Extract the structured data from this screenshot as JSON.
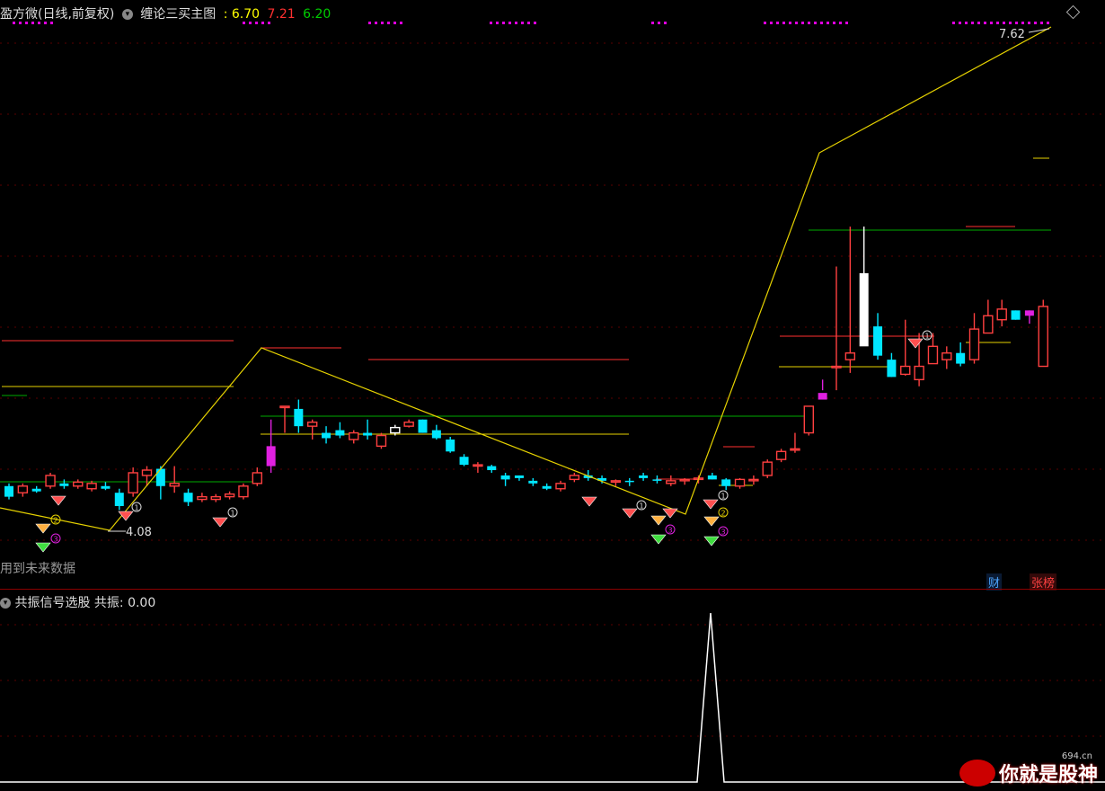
{
  "header": {
    "stock_title": "盈方微(日线,前复权)",
    "indicator_name": "缠论三买主图",
    "value1": ": 6.70",
    "value2": "7.21",
    "value3": "6.20",
    "colors": {
      "value1": "#ffff00",
      "value2": "#ff3030",
      "value3": "#00cc00"
    }
  },
  "main_chart": {
    "high_label": "7.62",
    "low_label": "4.08",
    "future_note": "用到未来数据",
    "badges": {
      "cai": "财",
      "zhangbang": "张榜"
    }
  },
  "sub_chart": {
    "title": "共振信号选股",
    "value_label": "共振: 0.00"
  },
  "watermark": {
    "text": "你就是股神",
    "site": "694.cn"
  },
  "chart_data": {
    "type": "candlestick",
    "y_range": [
      3.9,
      7.75
    ],
    "bar_count": 76,
    "ohlc": [
      [
        4.3,
        4.32,
        4.2,
        4.22
      ],
      [
        4.25,
        4.32,
        4.22,
        4.3
      ],
      [
        4.28,
        4.3,
        4.25,
        4.26
      ],
      [
        4.3,
        4.4,
        4.28,
        4.38
      ],
      [
        4.32,
        4.35,
        4.28,
        4.3
      ],
      [
        4.3,
        4.35,
        4.28,
        4.33
      ],
      [
        4.28,
        4.34,
        4.26,
        4.32
      ],
      [
        4.3,
        4.33,
        4.27,
        4.28
      ],
      [
        4.25,
        4.28,
        4.12,
        4.15
      ],
      [
        4.25,
        4.44,
        4.22,
        4.4
      ],
      [
        4.38,
        4.45,
        4.3,
        4.42
      ],
      [
        4.43,
        4.45,
        4.2,
        4.3
      ],
      [
        4.3,
        4.45,
        4.25,
        4.32
      ],
      [
        4.25,
        4.28,
        4.15,
        4.18
      ],
      [
        4.2,
        4.25,
        4.18,
        4.22
      ],
      [
        4.2,
        4.24,
        4.18,
        4.22
      ],
      [
        4.22,
        4.26,
        4.2,
        4.24
      ],
      [
        4.22,
        4.32,
        4.2,
        4.3
      ],
      [
        4.32,
        4.44,
        4.3,
        4.4
      ],
      [
        4.6,
        4.8,
        4.4,
        4.45
      ],
      [
        4.9,
        4.9,
        4.7,
        4.9
      ],
      [
        4.88,
        4.95,
        4.7,
        4.75
      ],
      [
        4.75,
        4.8,
        4.65,
        4.78
      ],
      [
        4.7,
        4.75,
        4.62,
        4.66
      ],
      [
        4.72,
        4.78,
        4.66,
        4.68
      ],
      [
        4.65,
        4.72,
        4.62,
        4.7
      ],
      [
        4.7,
        4.8,
        4.65,
        4.68
      ],
      [
        4.6,
        4.7,
        4.58,
        4.68
      ],
      [
        4.7,
        4.76,
        4.68,
        4.74
      ],
      [
        4.75,
        4.8,
        4.74,
        4.78
      ],
      [
        4.8,
        4.8,
        4.7,
        4.7
      ],
      [
        4.72,
        4.76,
        4.65,
        4.66
      ],
      [
        4.65,
        4.67,
        4.55,
        4.56
      ],
      [
        4.52,
        4.54,
        4.45,
        4.46
      ],
      [
        4.45,
        4.48,
        4.4,
        4.46
      ],
      [
        4.45,
        4.46,
        4.4,
        4.42
      ],
      [
        4.38,
        4.4,
        4.3,
        4.35
      ],
      [
        4.38,
        4.38,
        4.34,
        4.36
      ],
      [
        4.34,
        4.36,
        4.3,
        4.32
      ],
      [
        4.3,
        4.32,
        4.27,
        4.28
      ],
      [
        4.28,
        4.34,
        4.26,
        4.32
      ],
      [
        4.35,
        4.4,
        4.33,
        4.38
      ],
      [
        4.38,
        4.42,
        4.34,
        4.36
      ],
      [
        4.36,
        4.38,
        4.32,
        4.34
      ],
      [
        4.34,
        4.35,
        4.3,
        4.34
      ],
      [
        4.34,
        4.36,
        4.3,
        4.33
      ],
      [
        4.38,
        4.4,
        4.34,
        4.36
      ],
      [
        4.35,
        4.38,
        4.32,
        4.34
      ],
      [
        4.32,
        4.38,
        4.3,
        4.34
      ],
      [
        4.34,
        4.36,
        4.31,
        4.35
      ],
      [
        4.35,
        4.38,
        4.32,
        4.36
      ],
      [
        4.38,
        4.4,
        4.35,
        4.35
      ],
      [
        4.35,
        4.36,
        4.27,
        4.3
      ],
      [
        4.3,
        4.36,
        4.28,
        4.35
      ],
      [
        4.34,
        4.38,
        4.31,
        4.35
      ],
      [
        4.38,
        4.5,
        4.36,
        4.48
      ],
      [
        4.5,
        4.58,
        4.48,
        4.56
      ],
      [
        4.58,
        4.7,
        4.55,
        4.58
      ],
      [
        4.7,
        4.9,
        4.68,
        4.9
      ],
      [
        5.0,
        5.1,
        5.02,
        4.95
      ],
      [
        5.2,
        5.95,
        5.02,
        5.2
      ],
      [
        5.25,
        6.25,
        5.15,
        5.3
      ],
      [
        5.9,
        6.25,
        5.6,
        5.35
      ],
      [
        5.5,
        5.6,
        5.25,
        5.28
      ],
      [
        5.25,
        5.3,
        5.12,
        5.12
      ],
      [
        5.14,
        5.55,
        5.13,
        5.2
      ],
      [
        5.1,
        5.45,
        5.05,
        5.2
      ],
      [
        5.22,
        5.45,
        5.22,
        5.35
      ],
      [
        5.25,
        5.35,
        5.18,
        5.3
      ],
      [
        5.3,
        5.38,
        5.2,
        5.22
      ],
      [
        5.25,
        5.6,
        5.22,
        5.48
      ],
      [
        5.45,
        5.7,
        5.45,
        5.58
      ],
      [
        5.55,
        5.7,
        5.5,
        5.63
      ],
      [
        5.62,
        5.62,
        5.55,
        5.55
      ],
      [
        5.62,
        5.62,
        5.52,
        5.58
      ],
      [
        5.2,
        5.7,
        5.2,
        5.65
      ]
    ]
  }
}
